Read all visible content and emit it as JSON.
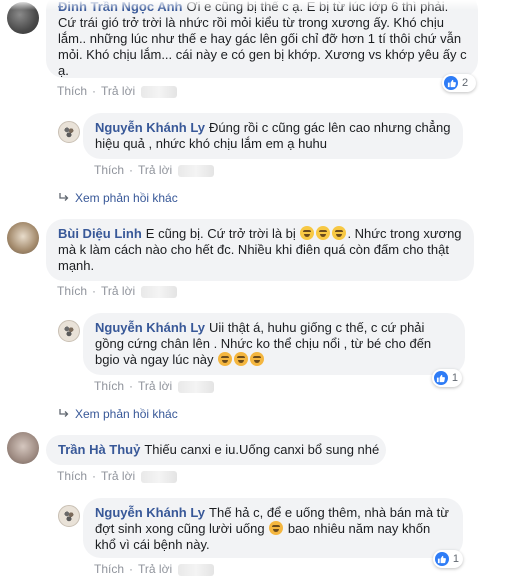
{
  "comment1": {
    "name": "Đinh Trần Ngọc Anh",
    "text_partial": "Ơi e cũng bị thế c ạ. E bị từ lúc lớp 6 thì phải.",
    "lines": [
      "Cứ trái gió trở trời là nhức rồi mỏi kiểu từ trong xương ấy. Khó chịu",
      "lắm.. những lúc như thế e hay gác lên gối chỉ đỡ hơn 1 tí thôi chứ vẫn",
      "mỏi. Khó chịu lắm... cái này e có gen bị khớp. Xương vs khớp yêu ấy c",
      "ạ."
    ],
    "like_label": "Thích",
    "reply_label": "Trả lời",
    "reaction_count": "2"
  },
  "reply1": {
    "name": "Nguyễn Khánh Ly",
    "text_line1": "Đúng rồi c cũng gác lên cao nhưng chẳng",
    "text_line2": "hiệu quả , nhức khó chịu lắm em ạ huhu",
    "like_label": "Thích",
    "reply_label": "Trả lời"
  },
  "more1": {
    "label": "Xem phản hồi khác"
  },
  "comment2": {
    "name": "Bùi Diệu Linh",
    "text_a": "E cũng bị. Cứ trở trời là bị",
    "text_b": ". Nhức trong xương",
    "line2": "mà k làm cách nào cho hết đc. Nhiều khi điên quá còn đấm cho thật",
    "line3": "mạnh.",
    "like_label": "Thích",
    "reply_label": "Trả lời"
  },
  "reply2": {
    "name": "Nguyễn Khánh Ly",
    "text_line1": "Uii thật á, huhu giống c thế, c cứ phải",
    "line2": "gồng cứng chân lên . Nhức ko thể chịu nổi , từ bé cho đến",
    "line3": "bgio và ngay lúc này",
    "like_label": "Thích",
    "reply_label": "Trả lời",
    "reaction_count": "1"
  },
  "more2": {
    "label": "Xem phản hồi khác"
  },
  "comment3": {
    "name": "Trần Hà Thuỷ",
    "text": "Thiếu canxi e iu.Uống canxi bổ sung nhé",
    "like_label": "Thích",
    "reply_label": "Trả lời"
  },
  "reply3": {
    "name": "Nguyễn Khánh Ly",
    "text_line1": "Thế hả c, để e uống thêm, nhà bán mà từ",
    "line2_a": "đợt sinh xong cũng lười uống",
    "line2_b": "bao nhiêu năm nay khốn",
    "line3": "khổ vì cái bệnh này.",
    "like_label": "Thích",
    "reply_label": "Trả lời",
    "reaction_count": "1"
  },
  "colors": {
    "name_blue": "#385898",
    "bubble": "#f2f3f5",
    "meta_gray": "#90949c",
    "like_blue": "#2e7cf6"
  }
}
